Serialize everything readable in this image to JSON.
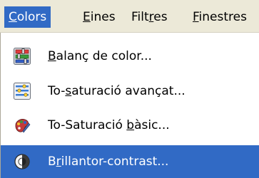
{
  "menubar": {
    "items": [
      {
        "pre": "",
        "key": "C",
        "post": "olors"
      },
      {
        "pre": "",
        "key": "E",
        "post": "ines"
      },
      {
        "pre": "Filt",
        "key": "r",
        "post": "es"
      },
      {
        "pre": "",
        "key": "F",
        "post": "inestres"
      }
    ],
    "active_index": 0
  },
  "menu": {
    "items": [
      {
        "pre": "",
        "key": "B",
        "post": "alanç de color...",
        "icon": "color-balance-icon"
      },
      {
        "pre": "To-",
        "key": "s",
        "post": "aturació avançat...",
        "icon": "hue-saturation-icon"
      },
      {
        "pre": "To-Saturació ",
        "key": "b",
        "post": "àsic...",
        "icon": "colorize-icon"
      },
      {
        "pre": "B",
        "key": "r",
        "post": "illantor-contrast...",
        "icon": "brightness-contrast-icon"
      }
    ],
    "highlighted_index": 3
  },
  "colors": {
    "highlight": "#316ac5",
    "menubar_bg": "#ece9d8"
  }
}
